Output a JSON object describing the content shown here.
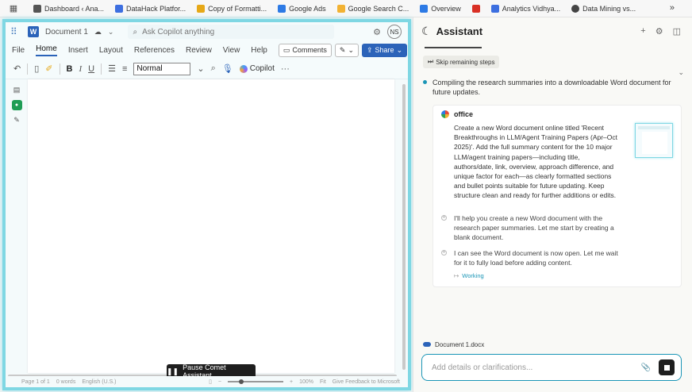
{
  "bookmarks": [
    {
      "label": "Dashboard ‹ Ana...",
      "icon": "dashboard-favicon",
      "color": "#555555"
    },
    {
      "label": "DataHack Platfor...",
      "icon": "chart-favicon",
      "color": "#3d6fe0"
    },
    {
      "label": "Copy of Formatti...",
      "icon": "link-favicon",
      "color": "#e6a817"
    },
    {
      "label": "Google Ads",
      "icon": "google-ads-favicon",
      "color": "#2d7ae5"
    },
    {
      "label": "Google Search C...",
      "icon": "search-console-favicon",
      "color": "#f2b233"
    },
    {
      "label": "Overview",
      "icon": "overview-favicon",
      "color": "#2d7ae5"
    },
    {
      "label": "",
      "icon": "s-favicon",
      "color": "#d93025"
    },
    {
      "label": "Analytics Vidhya...",
      "icon": "analytics-favicon",
      "color": "#3d6fe0"
    },
    {
      "label": "Data Mining vs...",
      "icon": "globe-favicon",
      "color": "#444444"
    }
  ],
  "word": {
    "doc_name": "Document 1",
    "search_placeholder": "Ask Copilot anything",
    "avatar_initials": "NS",
    "tabs": [
      "File",
      "Home",
      "Insert",
      "Layout",
      "References",
      "Review",
      "View",
      "Help"
    ],
    "active_tab": "Home",
    "comments_label": "Comments",
    "share_label": "Share",
    "style_value": "Normal",
    "copilot_label": "Copilot",
    "pause_label": "Pause Comet Assistant",
    "status": {
      "page": "Page 1 of 1",
      "words": "0 words",
      "language": "English (U.S.)",
      "zoom": "100%",
      "fit": "Fit",
      "feedback": "Give Feedback to Microsoft"
    }
  },
  "assistant": {
    "title": "Assistant",
    "skip_label": "Skip remaining steps",
    "step_text": "Compiling the research summaries into a downloadable Word document for future updates.",
    "card": {
      "source": "office",
      "prompt": "Create a new Word document online titled 'Recent Breakthroughs in LLM/Agent Training Papers (Apr–Oct 2025)'. Add the full summary content for the 10 major LLM/agent training papers—including title, authors/date, link, overview, approach difference, and unique factor for each—as clearly formatted sections and bullet points suitable for future updating. Keep structure clean and ready for further additions or edits.",
      "messages": [
        "I'll help you create a new Word document with the research paper summaries. Let me start by creating a blank document.",
        "I can see the Word document is now open. Let me wait for it to fully load before adding content."
      ],
      "working_label": "Working"
    },
    "attachment": "Document 1.docx",
    "input_placeholder": "Add details or clarifications..."
  }
}
